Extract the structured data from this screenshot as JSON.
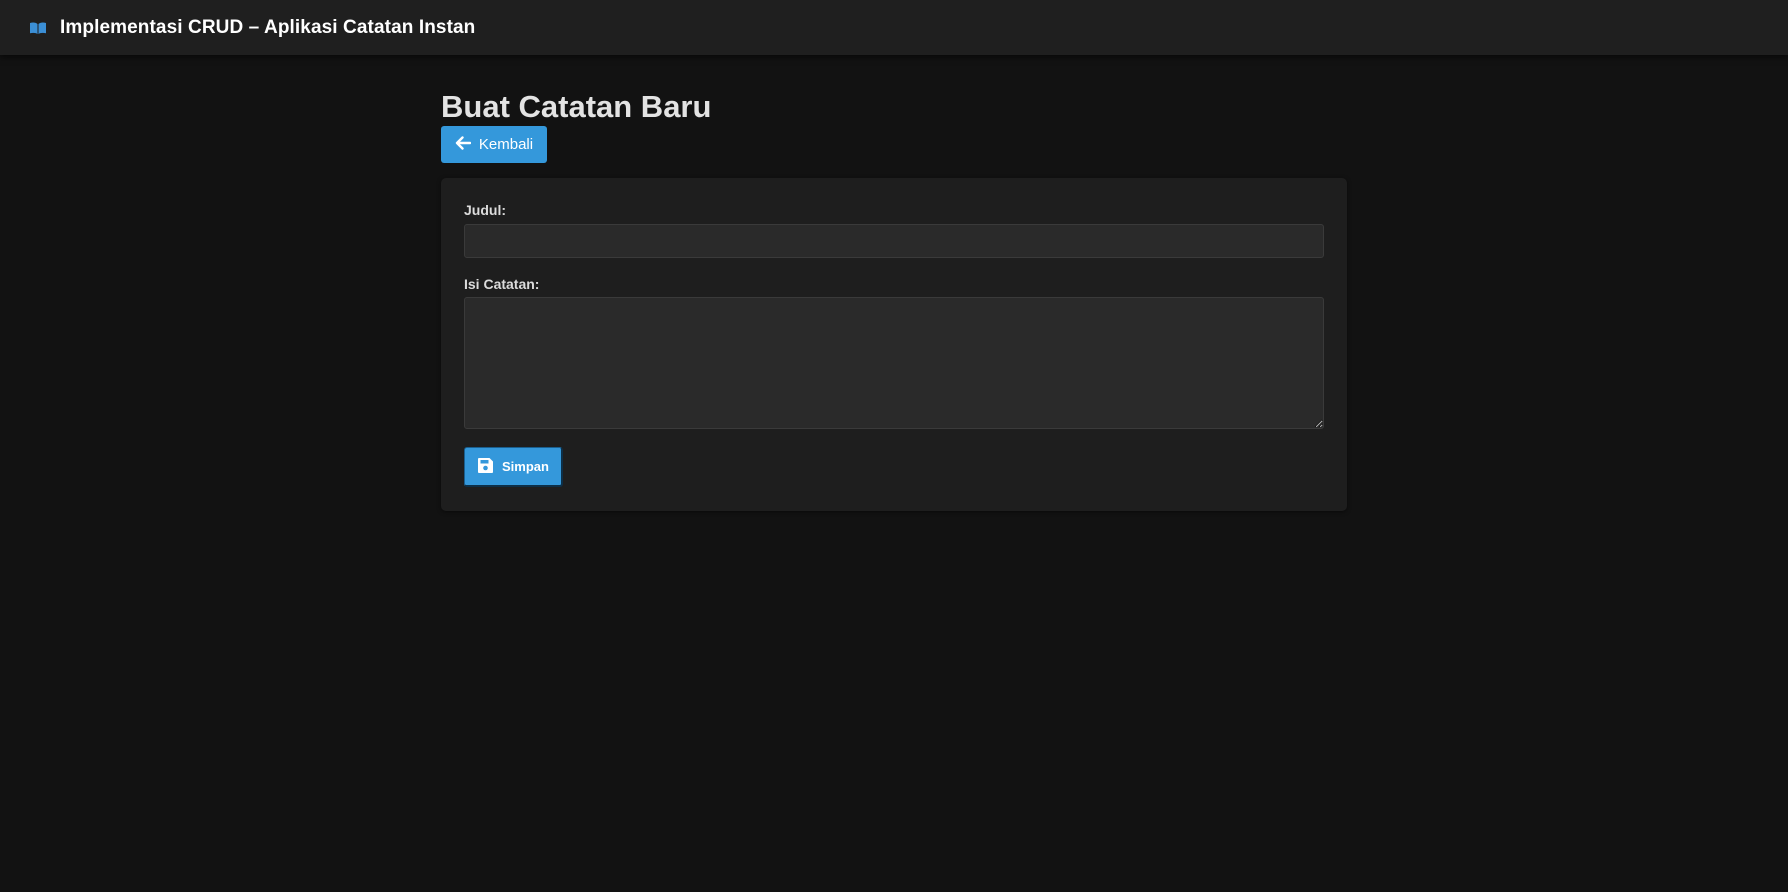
{
  "header": {
    "icon": "open-book-icon",
    "title": "Implementasi CRUD – Aplikasi Catatan Instan"
  },
  "page": {
    "title": "Buat Catatan Baru",
    "back_button": {
      "icon": "arrow-left-icon",
      "label": "Kembali"
    }
  },
  "form": {
    "title_label": "Judul:",
    "title_value": "",
    "content_label": "Isi Catatan:",
    "content_value": "",
    "save_button": {
      "icon": "floppy-disk-icon",
      "label": "Simpan"
    }
  },
  "colors": {
    "background": "#121212",
    "header_bg": "#1f1f1f",
    "card_bg": "#1e1e1e",
    "input_bg": "#2a2a2a",
    "accent": "#3498db",
    "text": "#e6e6e6"
  }
}
